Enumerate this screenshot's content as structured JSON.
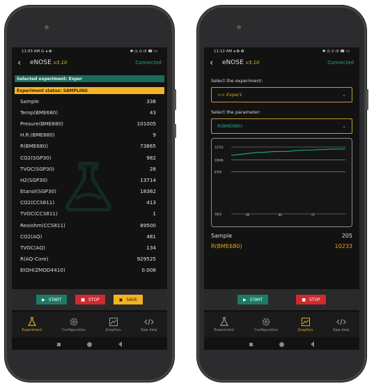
{
  "left": {
    "status": {
      "time": "11:03 AM",
      "left_icons": "⊡ ◂ ✿ ·",
      "right_icons": "✱ ◷ ⊙ ıll ☎ ▭"
    },
    "appbar": {
      "title": "eNOSE",
      "version": "v3.10",
      "connection": "Connected"
    },
    "selected_banner": "Selected experiment: Exper",
    "status_banner": "Experiment status: SAMPLING",
    "rows": [
      {
        "label": "Sample",
        "value": "338"
      },
      {
        "label": "Temp(BME680)",
        "value": "43"
      },
      {
        "label": "Presure(BME680)",
        "value": "101005"
      },
      {
        "label": "H.R.(BME680)",
        "value": "9"
      },
      {
        "label": "R(BME680)",
        "value": "73865"
      },
      {
        "label": "CO2(SGP30)",
        "value": "982"
      },
      {
        "label": "TVOC(SGP30)",
        "value": "28"
      },
      {
        "label": "H2(SGP30)",
        "value": "13714"
      },
      {
        "label": "Etanol(SGP30)",
        "value": "18362"
      },
      {
        "label": "CO2(CCS811)",
        "value": "413"
      },
      {
        "label": "TVOC(CCS811)",
        "value": "1"
      },
      {
        "label": "ResIohm(CCS811)",
        "value": "89500"
      },
      {
        "label": "CO2(AQ)",
        "value": "481"
      },
      {
        "label": "TVOC(AQ)",
        "value": "134"
      },
      {
        "label": "R(AQ-Core)",
        "value": "929525"
      },
      {
        "label": "EtOH(ZMOD4410)",
        "value": "0.008"
      }
    ],
    "buttons": {
      "start": "START",
      "stop": "STOP",
      "save": "SAVE"
    },
    "nav": {
      "experiment": "Experiment",
      "configuration": "Configuration",
      "graphics": "Graphics",
      "rawdata": "Raw data"
    }
  },
  "right": {
    "status": {
      "time": "11:12 AM",
      "left_icons": "◂ ✿ ✿",
      "right_icons": "✱ ◷ ⊙ ıll ☎ ▭"
    },
    "appbar": {
      "title": "eNOSE",
      "version": "v3.10",
      "connection": "Connected"
    },
    "experiment_label": "Select the experiment:",
    "experiment_value": ">> Exper1",
    "parameter_label": "Select the parameter:",
    "parameter_value": "R(BME680)",
    "sample_label": "Sample",
    "sample_value": "205",
    "param_label": "R(BME680)",
    "param_value": "10233",
    "buttons": {
      "start": "START",
      "stop": "STOP"
    },
    "nav": {
      "experiment": "Experiment",
      "configuration": "Configuration",
      "graphics": "Graphics",
      "rawdata": "Raw data"
    }
  },
  "colors": {
    "accent": "#e5a623",
    "teal": "#1d7a65",
    "connected": "#27a38c",
    "stop": "#d0292e"
  },
  "chart_data": {
    "type": "line",
    "title": "",
    "xlabel": "",
    "ylabel": "",
    "yticks": [
      "12712",
      "10606",
      "8700",
      "1812"
    ],
    "xticks": [
      "56",
      "64",
      "72"
    ],
    "ylim": [
      1812,
      12712
    ],
    "xlim": [
      52,
      80
    ],
    "series": [
      {
        "x": [
          52,
          54,
          56,
          58,
          60,
          62,
          64,
          66,
          68,
          70,
          72,
          74,
          76,
          78,
          80
        ],
        "y": [
          11350,
          11500,
          11650,
          11800,
          11850,
          11950,
          11980,
          12000,
          12150,
          12200,
          12230,
          12300,
          12350,
          12380,
          12400
        ]
      }
    ],
    "grid": true
  }
}
